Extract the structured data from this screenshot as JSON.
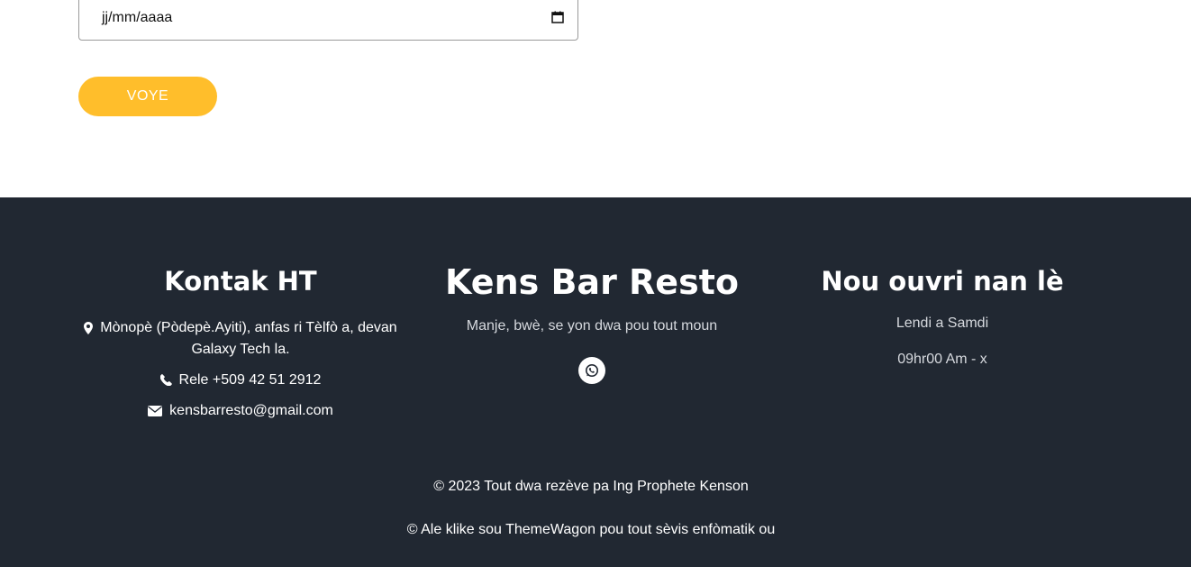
{
  "form": {
    "date_value": "jj/mm/aaaa",
    "submit_label": "VOYE"
  },
  "footer": {
    "contact": {
      "title": "Kontak HT",
      "address": "Mònopè (Pòdepè.Ayiti), anfas ri Tèlfò a, devan Galaxy Tech la.",
      "phone": "Rele +509 42 51 2912",
      "email": "kensbarresto@gmail.com"
    },
    "brand": {
      "title": "Kens Bar Resto",
      "tagline": "Manje, bwè, se yon dwa pou tout moun"
    },
    "hours": {
      "title": "Nou ouvri nan lè",
      "days": "Lendi a Samdi",
      "time": "09hr00 Am - x"
    },
    "copyright": "© 2023 Tout dwa rezève pa Ing Prophete Kenson",
    "credit": "© Ale klike sou ThemeWagon pou tout sèvis enfòmatik ou"
  },
  "colors": {
    "accent": "#ffbe2b",
    "footer_bg": "#212832"
  }
}
